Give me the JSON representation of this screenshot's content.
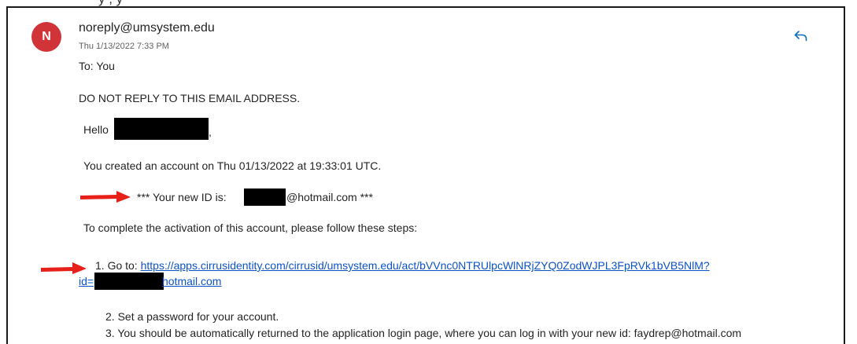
{
  "email": {
    "sender": "noreply@umsystem.edu",
    "avatar_initial": "N",
    "date": "Thu 1/13/2022 7:33 PM",
    "to_line": "To:  You",
    "reply_icon": "reply-icon"
  },
  "body": {
    "warning": "DO NOT REPLY TO THIS EMAIL ADDRESS.",
    "greeting": "Hello",
    "greeting_suffix": ",",
    "created": "You created an account on Thu 01/13/2022 at 19:33:01 UTC.",
    "new_id_prefix": "***  Your new ID is:",
    "new_id_suffix": "@hotmail.com  ***",
    "instructions": "To complete the activation of this account, please follow these steps:",
    "step1_prefix": "1. Go to:",
    "step1_link": "https://apps.cirrusidentity.com/cirrusid/umsystem.edu/act/bVVnc0NTRUlpcWlNRjZYQ0ZodWJPL3FpRVk1bVB5NlM?",
    "step1_link_line2_prefix": "id=",
    "step1_link_line2_suffix": "hotmail.com",
    "step2": "2. Set a password for your account.",
    "step3": "3. You should be automatically returned to the application login page, where you can log in with your new id: faydrep@hotmail.com"
  },
  "annotations": {
    "arrow_color": "#e8201a",
    "redaction_color": "#000000"
  },
  "top_cutoff_text": "y           ,                                                                    y"
}
